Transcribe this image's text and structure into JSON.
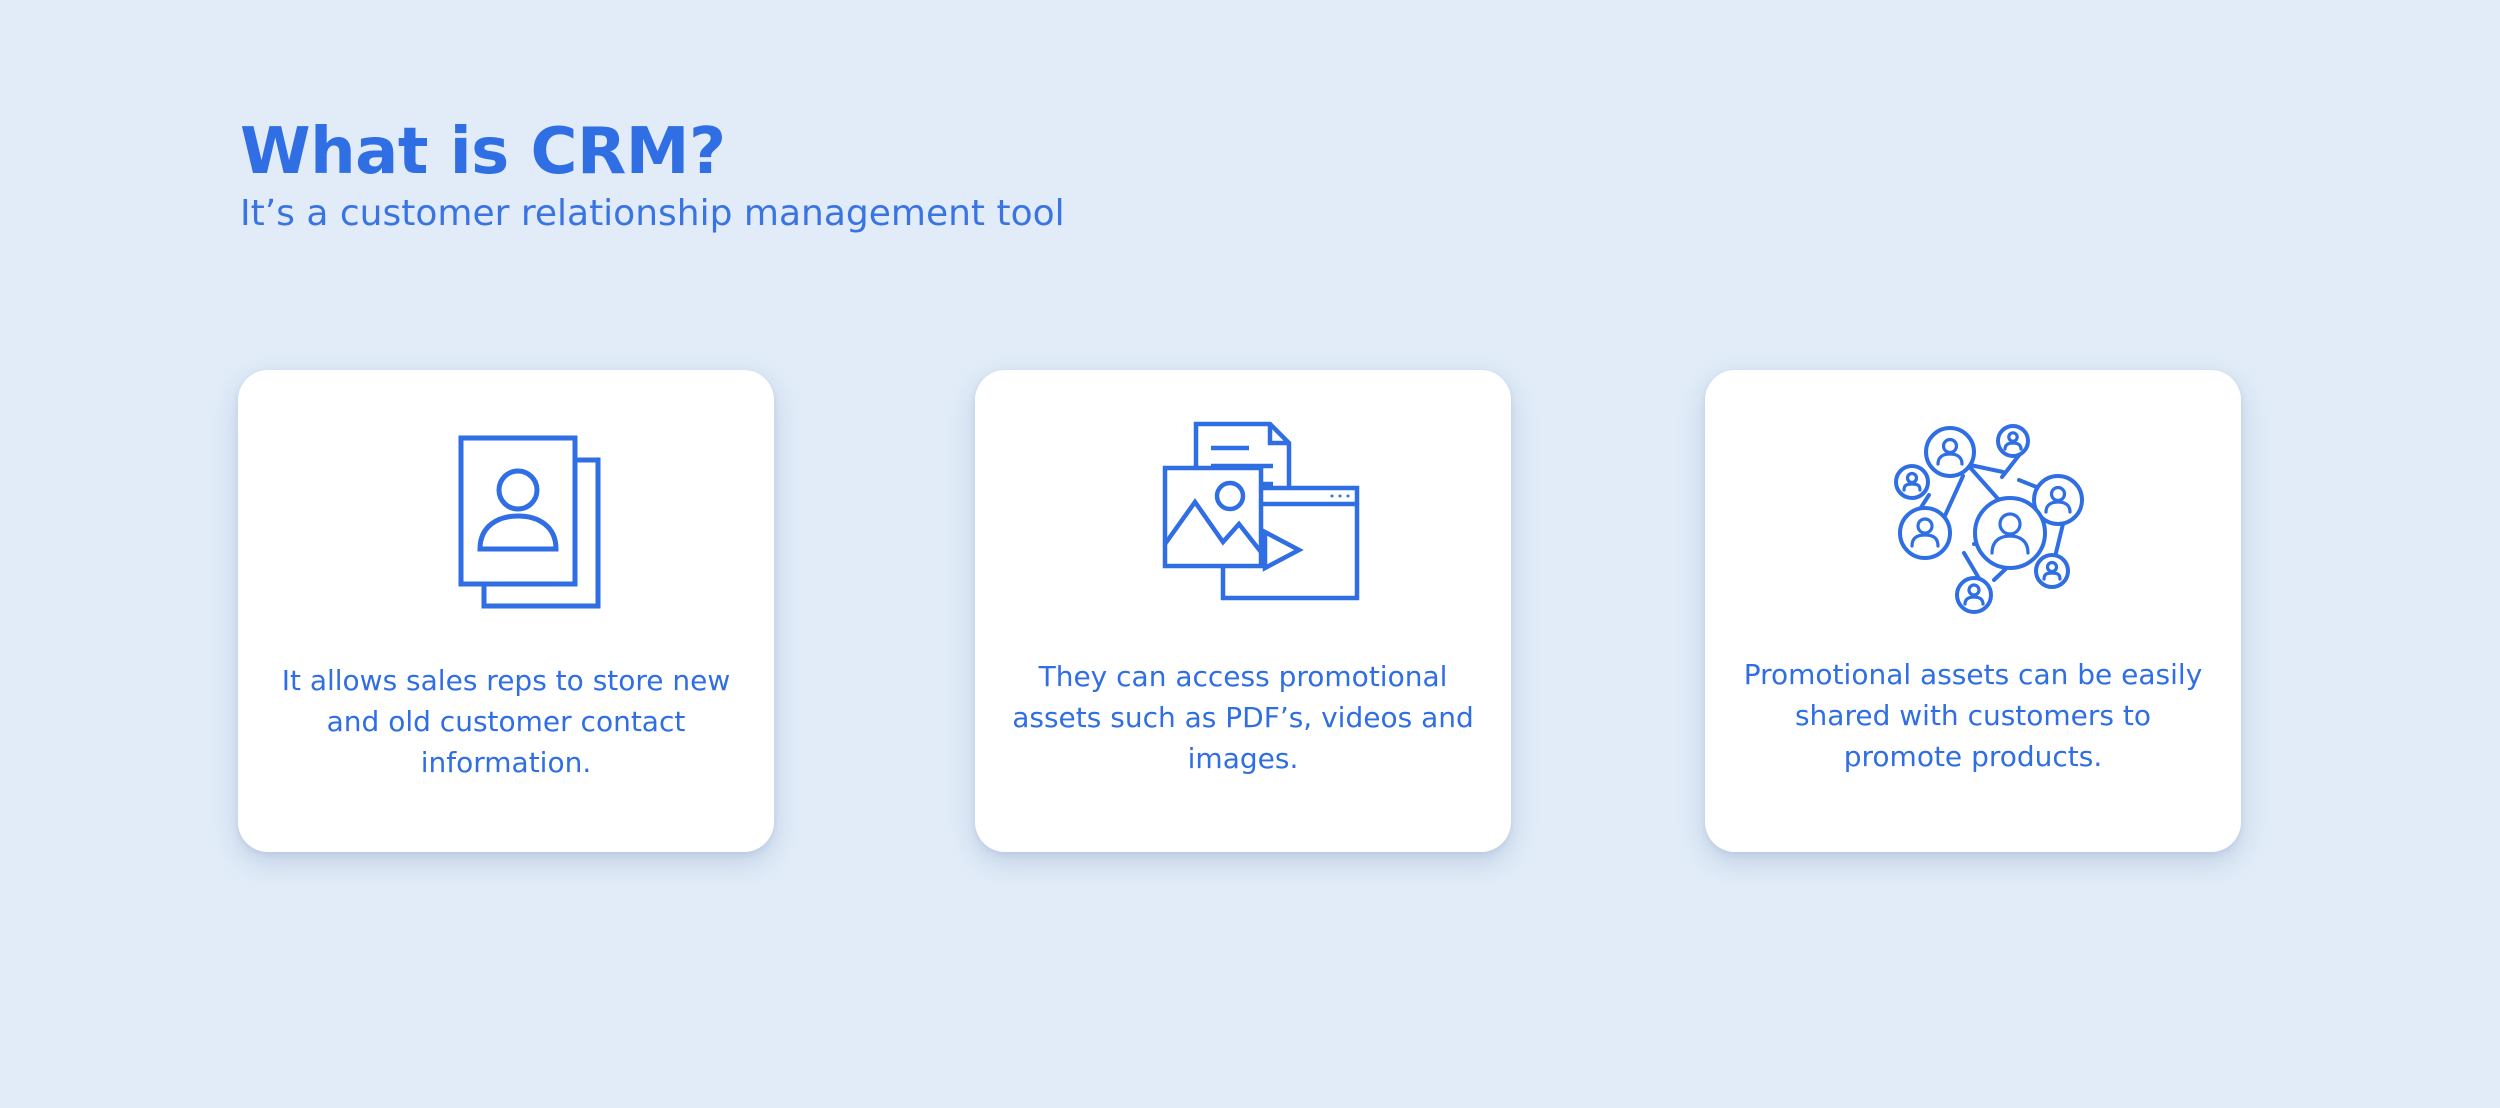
{
  "header": {
    "title": "What is CRM?",
    "subtitle": "It’s a customer relationship management tool"
  },
  "cards": [
    {
      "icon": "contact-card-icon",
      "text": "It allows sales reps to store new and old customer contact information."
    },
    {
      "icon": "media-assets-icon",
      "text": "They can access promotional assets such as PDF’s, videos and images."
    },
    {
      "icon": "customer-network-icon",
      "text": "Promotional assets can be easily shared with customers to promote products."
    }
  ],
  "colors": {
    "background": "#e1ecf8",
    "accent": "#2f6ee3",
    "card": "#ffffff"
  }
}
